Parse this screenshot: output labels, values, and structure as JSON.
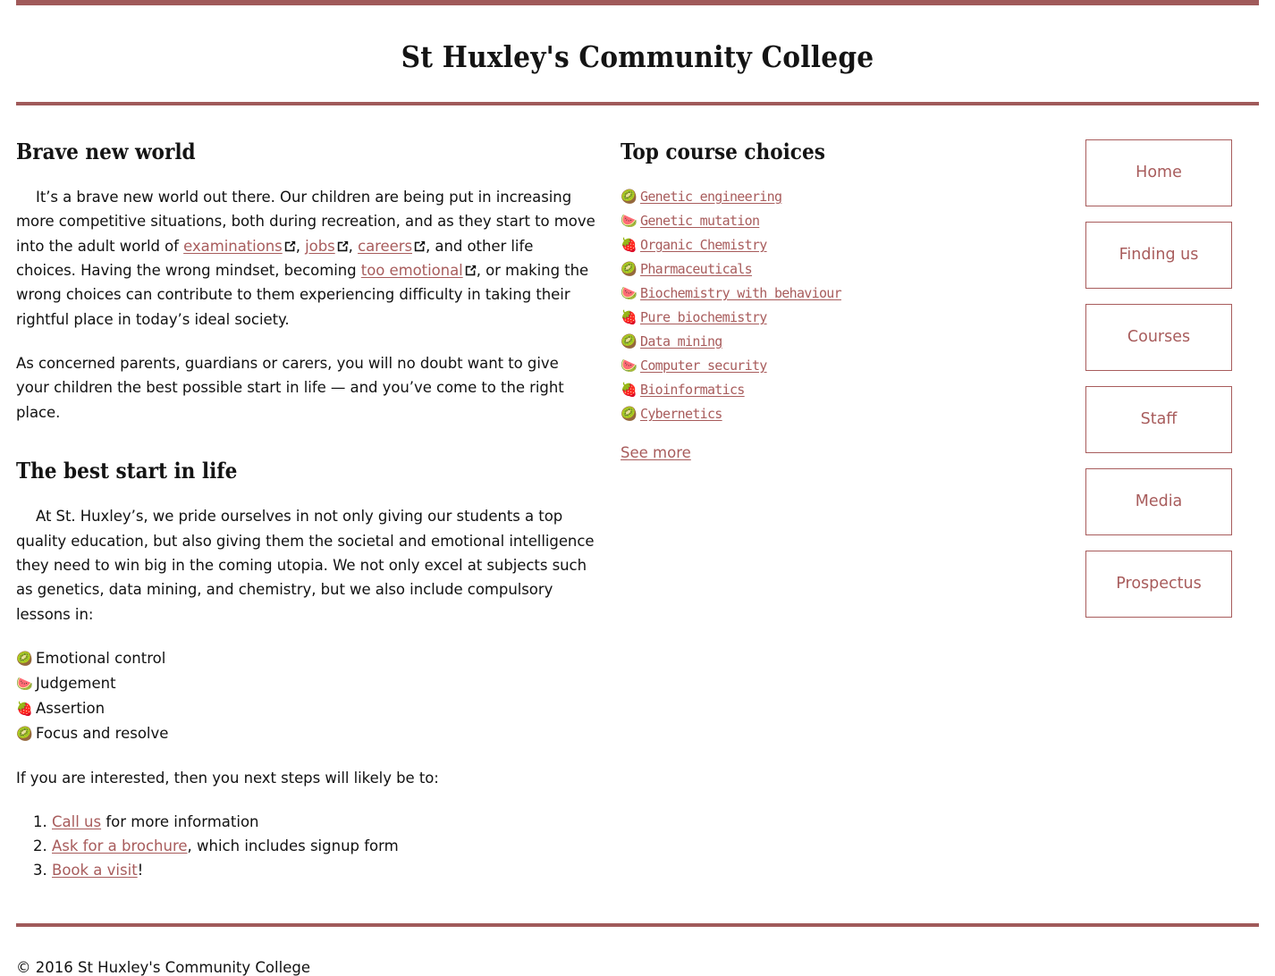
{
  "site": {
    "title": "St Huxley's Community College",
    "brand_color": "#a05a5a",
    "link_color": "#a85c5c"
  },
  "main": {
    "heading_1": "Brave new world",
    "para_1_part_1": "It’s a brave new world out there. Our children are being put in increasing more competitive situations, both during recreation, and as they start to move into the adult world of ",
    "link_examinations": "examinations",
    "para_1_sep_1": ", ",
    "link_jobs": "jobs",
    "para_1_sep_2": ", ",
    "link_careers": "careers",
    "para_1_part_2": ", and other life choices. Having the wrong mindset, becoming ",
    "link_too_emotional": "too emotional",
    "para_1_part_3": ", or making the wrong choices can contribute to them experiencing difficulty in taking their rightful place in today’s ideal society.",
    "para_2": "As concerned parents, guardians or carers, you will no doubt want to give your children the best possible start in life — and you’ve come to the right place.",
    "heading_2": "The best start in life",
    "para_3": "At St. Huxley’s, we pride ourselves in not only giving our students a top quality education, but also giving them the societal and emotional intelligence they need to win big in the coming utopia. We not only excel at subjects such as genetics, data mining, and chemistry, but we also include compulsory lessons in:",
    "compulsory_lessons": [
      {
        "icon": "kiwi-icon",
        "glyph": "🥝",
        "label": "Emotional control"
      },
      {
        "icon": "watermelon-icon",
        "glyph": "🍉",
        "label": "Judgement"
      },
      {
        "icon": "strawberry-icon",
        "glyph": "🍓",
        "label": "Assertion"
      },
      {
        "icon": "kiwi-icon",
        "glyph": "🥝",
        "label": "Focus and resolve"
      }
    ],
    "para_4": "If you are interested, then you next steps will likely be to:",
    "next_steps": [
      {
        "link": "Call us",
        "rest": " for more information"
      },
      {
        "link": "Ask for a brochure",
        "rest": ", which includes signup form"
      },
      {
        "link": "Book a visit",
        "rest": "!"
      }
    ]
  },
  "courses": {
    "heading": "Top course choices",
    "items": [
      {
        "icon": "kiwi-icon",
        "glyph": "🥝",
        "label": "Genetic engineering"
      },
      {
        "icon": "watermelon-icon",
        "glyph": "🍉",
        "label": "Genetic mutation"
      },
      {
        "icon": "strawberry-icon",
        "glyph": "🍓",
        "label": "Organic Chemistry"
      },
      {
        "icon": "kiwi-icon",
        "glyph": "🥝",
        "label": "Pharmaceuticals"
      },
      {
        "icon": "watermelon-icon",
        "glyph": "🍉",
        "label": "Biochemistry with behaviour"
      },
      {
        "icon": "strawberry-icon",
        "glyph": "🍓",
        "label": "Pure biochemistry"
      },
      {
        "icon": "kiwi-icon",
        "glyph": "🥝",
        "label": "Data mining"
      },
      {
        "icon": "watermelon-icon",
        "glyph": "🍉",
        "label": "Computer security"
      },
      {
        "icon": "strawberry-icon",
        "glyph": "🍓",
        "label": "Bioinformatics"
      },
      {
        "icon": "kiwi-icon",
        "glyph": "🥝",
        "label": "Cybernetics"
      }
    ],
    "see_more": "See more"
  },
  "nav": {
    "items": [
      {
        "name": "home",
        "label": "Home"
      },
      {
        "name": "finding-us",
        "label": "Finding us"
      },
      {
        "name": "courses",
        "label": "Courses"
      },
      {
        "name": "staff",
        "label": "Staff"
      },
      {
        "name": "media",
        "label": "Media"
      },
      {
        "name": "prospectus",
        "label": "Prospectus"
      }
    ]
  },
  "footer": {
    "copyright": "© 2016 St Huxley's Community College"
  }
}
